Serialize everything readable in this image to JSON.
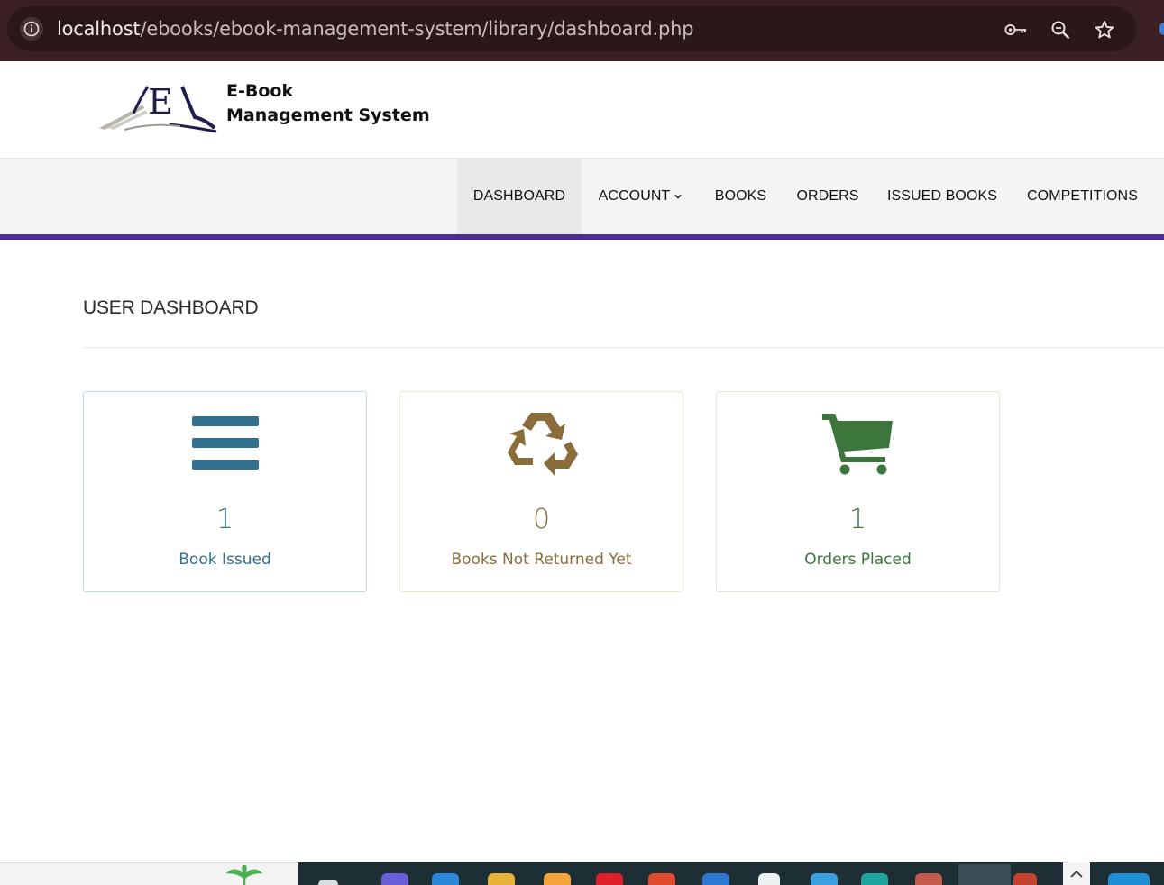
{
  "browser": {
    "url_host": "localhost",
    "url_path": "/ebooks/ebook-management-system/library/dashboard.php",
    "icons": [
      "info-icon",
      "key-icon",
      "zoom-icon",
      "star-icon"
    ]
  },
  "brand": {
    "logo_letters": "E",
    "name_line1": "E-Book",
    "name_line2": "Management System"
  },
  "nav": {
    "items": [
      {
        "label": "DASHBOARD",
        "active": true
      },
      {
        "label": "ACCOUNT",
        "active": false,
        "dropdown": true
      },
      {
        "label": "BOOKS",
        "active": false
      },
      {
        "label": "ORDERS",
        "active": false
      },
      {
        "label": "ISSUED BOOKS",
        "active": false
      },
      {
        "label": "COMPETITIONS",
        "active": false
      }
    ],
    "accent_color": "#4f2d8c"
  },
  "page": {
    "title": "USER DASHBOARD"
  },
  "cards": [
    {
      "icon": "bars-icon",
      "count": "1",
      "label": "Book Issued",
      "color": "#31708f"
    },
    {
      "icon": "recycle-icon",
      "count": "0",
      "label": "Books Not Returned Yet",
      "color": "#8a6d3b"
    },
    {
      "icon": "shopping-cart-icon",
      "count": "1",
      "label": "Orders Placed",
      "color": "#3c763d"
    }
  ]
}
